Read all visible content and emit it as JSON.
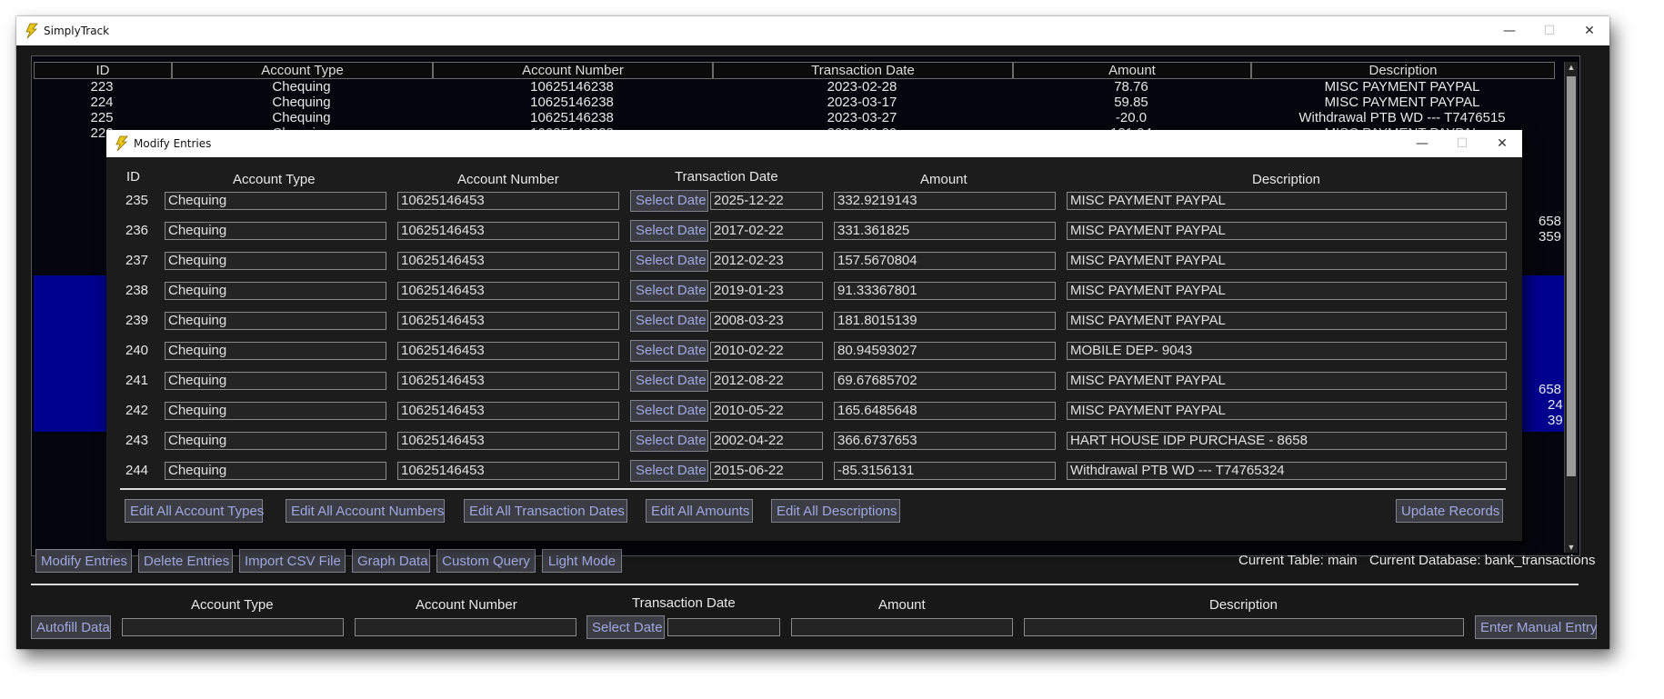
{
  "window": {
    "title": "SimplyTrack",
    "minimize": "—",
    "maximize": "☐",
    "close": "✕"
  },
  "table": {
    "columns": [
      "ID",
      "Account Type",
      "Account Number",
      "Transaction Date",
      "Amount",
      "Description"
    ],
    "rows": [
      [
        "223",
        "Chequing",
        "10625146238",
        "2023-02-28",
        "78.76",
        "MISC PAYMENT PAYPAL"
      ],
      [
        "224",
        "Chequing",
        "10625146238",
        "2023-03-17",
        "59.85",
        "MISC PAYMENT PAYPAL"
      ],
      [
        "225",
        "Chequing",
        "10625146238",
        "2023-03-27",
        "-20.0",
        "Withdrawal PTB WD --- T7476515"
      ],
      [
        "226",
        "Chequing",
        "10625146238",
        "2023-03-29",
        "121.94",
        "MISC PAYMENT PAYPAL"
      ]
    ],
    "partial_right": [
      "658",
      "359",
      "658",
      "24",
      "39"
    ]
  },
  "toolbar": {
    "buttons": [
      "Modify Entries",
      "Delete Entries",
      "Import CSV File",
      "Graph Data",
      "Custom Query",
      "Light Mode"
    ],
    "current_table": "Current Table: main",
    "current_database": "Current Database: bank_transactions"
  },
  "entry_form": {
    "autofill": "Autofill Data",
    "labels": {
      "account_type": "Account Type",
      "account_number": "Account Number",
      "transaction_date": "Transaction Date",
      "amount": "Amount",
      "description": "Description"
    },
    "select_date": "Select Date",
    "enter": "Enter Manual Entry"
  },
  "dialog": {
    "title": "Modify Entries",
    "headers": {
      "id": "ID",
      "account_type": "Account Type",
      "account_number": "Account Number",
      "transaction_date": "Transaction Date",
      "amount": "Amount",
      "description": "Description"
    },
    "select_date": "Select Date",
    "rows": [
      {
        "id": "235",
        "type": "Chequing",
        "number": "10625146453",
        "date": "2025-12-22",
        "amount": "332.9219143",
        "desc": "MISC PAYMENT PAYPAL"
      },
      {
        "id": "236",
        "type": "Chequing",
        "number": "10625146453",
        "date": "2017-02-22",
        "amount": "331.361825",
        "desc": "MISC PAYMENT PAYPAL"
      },
      {
        "id": "237",
        "type": "Chequing",
        "number": "10625146453",
        "date": "2012-02-23",
        "amount": "157.5670804",
        "desc": "MISC PAYMENT PAYPAL"
      },
      {
        "id": "238",
        "type": "Chequing",
        "number": "10625146453",
        "date": "2019-01-23",
        "amount": "91.33367801",
        "desc": "MISC PAYMENT PAYPAL"
      },
      {
        "id": "239",
        "type": "Chequing",
        "number": "10625146453",
        "date": "2008-03-23",
        "amount": "181.8015139",
        "desc": "MISC PAYMENT PAYPAL"
      },
      {
        "id": "240",
        "type": "Chequing",
        "number": "10625146453",
        "date": "2010-02-22",
        "amount": "80.94593027",
        "desc": "MOBILE DEP- 9043"
      },
      {
        "id": "241",
        "type": "Chequing",
        "number": "10625146453",
        "date": "2012-08-22",
        "amount": "69.67685702",
        "desc": "MISC PAYMENT PAYPAL"
      },
      {
        "id": "242",
        "type": "Chequing",
        "number": "10625146453",
        "date": "2010-05-22",
        "amount": "165.6485648",
        "desc": "MISC PAYMENT PAYPAL"
      },
      {
        "id": "243",
        "type": "Chequing",
        "number": "10625146453",
        "date": "2002-04-22",
        "amount": "366.6737653",
        "desc": "HART HOUSE IDP PURCHASE - 8658"
      },
      {
        "id": "244",
        "type": "Chequing",
        "number": "10625146453",
        "date": "2015-06-22",
        "amount": "-85.3156131",
        "desc": "Withdrawal PTB WD --- T74765324"
      }
    ],
    "bulk_buttons": [
      "Edit All Account Types",
      "Edit All Account Numbers",
      "Edit All Transaction Dates",
      "Edit All Amounts",
      "Edit All Descriptions"
    ],
    "update": "Update Records"
  },
  "colors": {
    "background": "#181818",
    "selection": "#00008f",
    "button_text": "#9fa8e0",
    "logo": "#e8c61a"
  },
  "icons": {
    "app": "lightning-logo-icon",
    "minimize": "minimize-icon",
    "maximize": "maximize-icon",
    "close": "close-icon"
  }
}
